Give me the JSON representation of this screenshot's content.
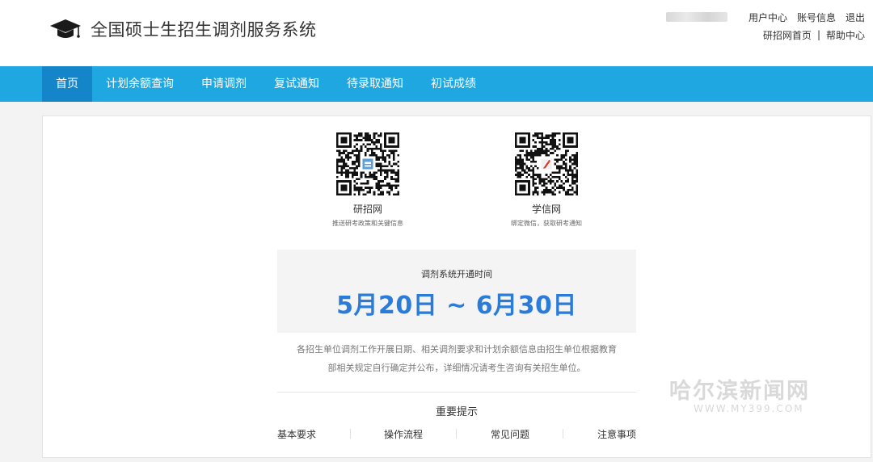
{
  "header": {
    "site_title": "全国硕士生招生调剂服务系统",
    "user_links": [
      "用户中心",
      "账号信息",
      "退出"
    ],
    "secondary_links": [
      "研招网首页",
      "帮助中心"
    ],
    "secondary_sep": "|"
  },
  "nav": {
    "items": [
      "首页",
      "计划余额查询",
      "申请调剂",
      "复试通知",
      "待录取通知",
      "初试成绩"
    ],
    "active_index": 0
  },
  "qr_codes": [
    {
      "name": "研招网",
      "desc": "推送研考政策和关键信息"
    },
    {
      "name": "学信网",
      "desc": "绑定微信，获取研考通知"
    }
  ],
  "open_time": {
    "label": "调剂系统开通时间",
    "dates": "5月20日 ~ 6月30日"
  },
  "notice": {
    "line1": "各招生单位调剂工作开展日期、相关调剂要求和计划余额信息由招生单位根据教育",
    "line2": "部相关规定自行确定并公布，详细情况请考生咨询有关招生单位。"
  },
  "tips": {
    "title": "重要提示",
    "links": [
      "基本要求",
      "操作流程",
      "常见问题",
      "注意事项"
    ]
  },
  "watermark": {
    "text": "哈尔滨新闻网",
    "url": "WWW.MY399.COM"
  },
  "colors": {
    "nav_bg": "#1fa7e1",
    "nav_active": "#1485c8",
    "accent_dates": "#2b7bd8"
  }
}
